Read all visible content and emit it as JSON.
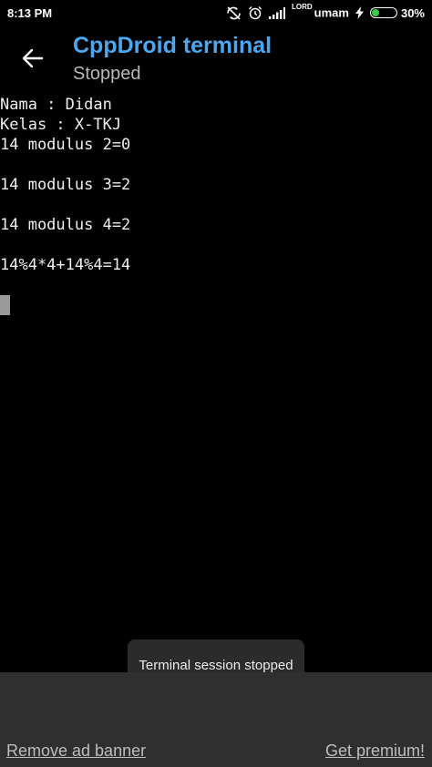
{
  "status_bar": {
    "time": "8:13 PM",
    "carrier_sup": "LORD",
    "carrier": "umam",
    "battery_percent": "30%",
    "battery_level": 0.3,
    "battery_color": "#35d14e",
    "icons": [
      "sync-off-icon",
      "alarm-icon",
      "signal-icon",
      "charging-icon",
      "battery-icon"
    ]
  },
  "app_bar": {
    "title": "CppDroid terminal",
    "subtitle": "Stopped",
    "title_color": "#4aa7f0"
  },
  "terminal": {
    "lines": [
      "Nama : Didan",
      "Kelas : X-TKJ",
      "14 modulus 2=0",
      "",
      "14 modulus 3=2",
      "",
      "14 modulus 4=2",
      "",
      "14%4*4+14%4=14",
      ""
    ]
  },
  "toast": {
    "text": "Terminal session stopped"
  },
  "footer": {
    "remove_ad": "Remove ad banner",
    "get_premium": "Get premium!"
  }
}
